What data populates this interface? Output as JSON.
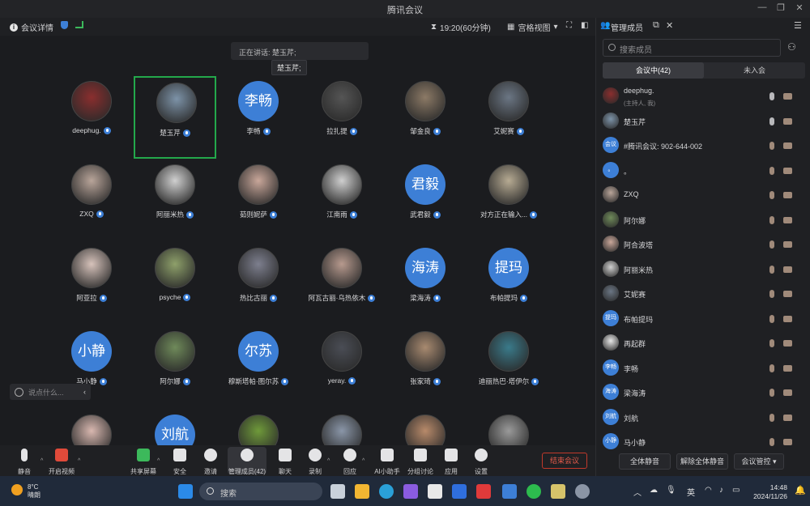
{
  "window": {
    "title": "腾讯会议"
  },
  "toolbar": {
    "meeting_info": "会议详情",
    "timer": "19:20(60分钟)",
    "view_mode": "宫格视图",
    "manage_members": "管理成员"
  },
  "stage": {
    "speaking_label": "正在讲话: 楚玉芹;",
    "speaking_tooltip": "楚玉芹;",
    "chat_placeholder": "说点什么...",
    "tiles": [
      {
        "name": "deephug.",
        "avatar": "",
        "color": "#8a2e2e",
        "active": false
      },
      {
        "name": "楚玉芹",
        "avatar": "",
        "color": "#7d93a8",
        "active": true
      },
      {
        "name": "李畅",
        "avatar": "李畅",
        "color": "#3d7fd6",
        "active": false
      },
      {
        "name": "拉扎提",
        "avatar": "",
        "color": "#555555",
        "active": false
      },
      {
        "name": "邹金良",
        "avatar": "",
        "color": "#8c7a66",
        "active": false
      },
      {
        "name": "艾妮赛",
        "avatar": "",
        "color": "#6b7684",
        "active": false
      },
      {
        "name": "ZXQ",
        "avatar": "",
        "color": "#b9a59a",
        "active": false
      },
      {
        "name": "阿丽米热",
        "avatar": "",
        "color": "#d0d0d0",
        "active": false
      },
      {
        "name": "茹则妮萨",
        "avatar": "",
        "color": "#c9a79a",
        "active": false
      },
      {
        "name": "江南雨",
        "avatar": "",
        "color": "#cfcfcf",
        "active": false
      },
      {
        "name": "武君毅",
        "avatar": "君毅",
        "color": "#3d7fd6",
        "active": false
      },
      {
        "name": "对方正在输入...",
        "avatar": "",
        "color": "#b7ab93",
        "active": false
      },
      {
        "name": "阿亚拉",
        "avatar": "",
        "color": "#d7c3bb",
        "active": false
      },
      {
        "name": "psyche",
        "avatar": "",
        "color": "#8ea06a",
        "active": false
      },
      {
        "name": "热比古丽",
        "avatar": "",
        "color": "#7d7f8e",
        "active": false
      },
      {
        "name": "阿瓦古丽·乌热依木",
        "avatar": "",
        "color": "#b79a8e",
        "active": false
      },
      {
        "name": "梁海涛",
        "avatar": "海涛",
        "color": "#3d7fd6",
        "active": false
      },
      {
        "name": "布帕提玛",
        "avatar": "提玛",
        "color": "#3d7fd6",
        "active": false
      },
      {
        "name": "马小静",
        "avatar": "小静",
        "color": "#3d7fd6",
        "active": false
      },
      {
        "name": "阿尔娜",
        "avatar": "",
        "color": "#6f8a5a",
        "active": false
      },
      {
        "name": "穆斯塔帕·图尔苏",
        "avatar": "尔苏",
        "color": "#3d7fd6",
        "active": false
      },
      {
        "name": "yeray.",
        "avatar": "",
        "color": "#4a4d55",
        "active": false
      },
      {
        "name": "张家琦",
        "avatar": "",
        "color": "#a88a70",
        "active": false
      },
      {
        "name": "迪丽热巴·塔伊尔",
        "avatar": "",
        "color": "#3a7a8a",
        "active": false
      },
      {
        "name": "",
        "avatar": "",
        "color": "#d9b8b0",
        "active": false
      },
      {
        "name": "",
        "avatar": "刘航",
        "color": "#3d7fd6",
        "active": false
      },
      {
        "name": "",
        "avatar": "",
        "color": "#6f9a3a",
        "active": false
      },
      {
        "name": "",
        "avatar": "",
        "color": "#8a96a8",
        "active": false
      },
      {
        "name": "",
        "avatar": "",
        "color": "#b88a6a",
        "active": false
      },
      {
        "name": "",
        "avatar": "",
        "color": "#9a9a9a",
        "active": false
      }
    ]
  },
  "controls": {
    "mute": "静音",
    "start_video": "开启视频",
    "share_screen": "共享屏幕",
    "security": "安全",
    "invite": "邀请",
    "manage_members": "管理成员(42)",
    "chat": "聊天",
    "record": "录制",
    "reactions": "回应",
    "ai_assistant": "AI小助手",
    "breakout": "分组讨论",
    "apps": "应用",
    "settings": "设置",
    "end_meeting": "结束会议"
  },
  "panel": {
    "title": "管理成员",
    "search_placeholder": "搜索成员",
    "tab_in_meeting": "会议中(42)",
    "tab_not_joined": "未入会",
    "members": [
      {
        "name": "deephug.",
        "sub": "(主持人, 我)",
        "avatar": "",
        "color": "#8a2e2e",
        "mic_on": true
      },
      {
        "name": "楚玉芹",
        "sub": "",
        "avatar": "",
        "color": "#7d93a8",
        "mic_on": true
      },
      {
        "name": "#腾讯会议: 902-644-002",
        "sub": "",
        "avatar": "会议",
        "color": "#3d7fd6",
        "mic_on": false
      },
      {
        "name": "。",
        "sub": "",
        "avatar": "。",
        "color": "#3d7fd6",
        "mic_on": false
      },
      {
        "name": "ZXQ",
        "sub": "",
        "avatar": "",
        "color": "#b9a59a",
        "mic_on": false
      },
      {
        "name": "阿尔娜",
        "sub": "",
        "avatar": "",
        "color": "#6f8a5a",
        "mic_on": false
      },
      {
        "name": "阿合波塔",
        "sub": "",
        "avatar": "",
        "color": "#c9a79a",
        "mic_on": false
      },
      {
        "name": "阿丽米热",
        "sub": "",
        "avatar": "",
        "color": "#d0d0d0",
        "mic_on": false
      },
      {
        "name": "艾妮赛",
        "sub": "",
        "avatar": "",
        "color": "#6b7684",
        "mic_on": false
      },
      {
        "name": "布帕提玛",
        "sub": "",
        "avatar": "提玛",
        "color": "#3d7fd6",
        "mic_on": false
      },
      {
        "name": "再起群",
        "sub": "",
        "avatar": "",
        "color": "#e8e8e8",
        "mic_on": false
      },
      {
        "name": "李畅",
        "sub": "",
        "avatar": "李畅",
        "color": "#3d7fd6",
        "mic_on": false
      },
      {
        "name": "梁海涛",
        "sub": "",
        "avatar": "海涛",
        "color": "#3d7fd6",
        "mic_on": false
      },
      {
        "name": "刘航",
        "sub": "",
        "avatar": "刘航",
        "color": "#3d7fd6",
        "mic_on": false
      },
      {
        "name": "马小静",
        "sub": "",
        "avatar": "小静",
        "color": "#3d7fd6",
        "mic_on": false
      }
    ],
    "mute_all": "全体静音",
    "unmute_all": "解除全体静音",
    "meeting_control": "会议管控"
  },
  "taskbar": {
    "temperature": "8°C",
    "weather": "晴朗",
    "search": "搜索",
    "ime": "英",
    "time": "14:48",
    "date": "2024/11/26"
  }
}
